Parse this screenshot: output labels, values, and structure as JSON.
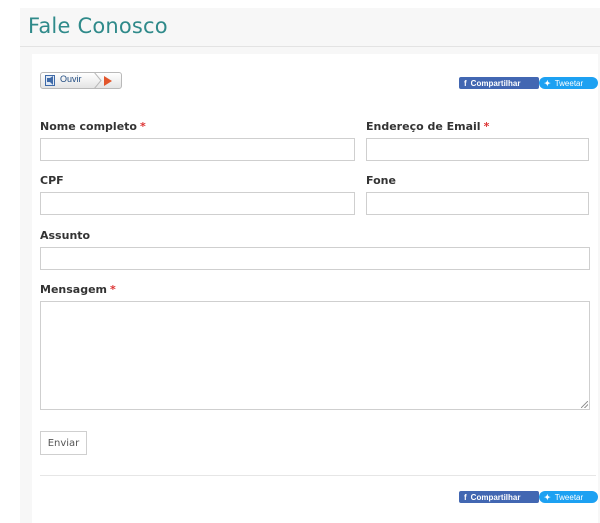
{
  "page": {
    "title": "Fale Conosco"
  },
  "listen": {
    "label": "Ouvir"
  },
  "share": {
    "facebook_label": "Compartilhar",
    "twitter_label": "Tweetar"
  },
  "form": {
    "name_label": "Nome completo",
    "email_label": "Endereço de Email",
    "cpf_label": "CPF",
    "phone_label": "Fone",
    "subject_label": "Assunto",
    "message_label": "Mensagem",
    "required_marker": "*",
    "name_value": "",
    "email_value": "",
    "cpf_value": "",
    "phone_value": "",
    "subject_value": "",
    "message_value": "",
    "submit_label": "Enviar"
  },
  "colors": {
    "title": "#2f8a8a",
    "facebook": "#4267b2",
    "twitter": "#1da1f2",
    "required": "#dd3333",
    "play": "#e2552b"
  },
  "icons": {
    "listen": "speaker-page-icon",
    "play": "play-icon",
    "facebook": "facebook-icon",
    "twitter": "twitter-bird-icon"
  }
}
